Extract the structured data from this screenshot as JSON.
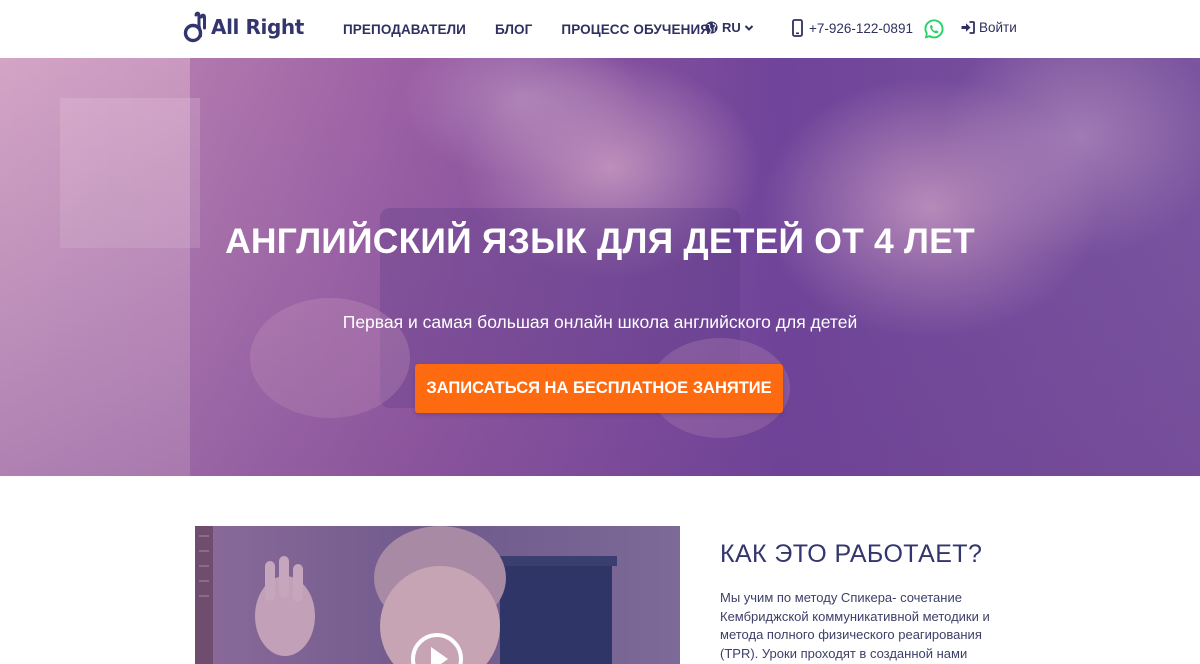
{
  "header": {
    "logo_text": "All Right",
    "nav": [
      {
        "label": "ПРЕПОДАВАТЕЛИ"
      },
      {
        "label": "БЛОГ"
      },
      {
        "label": "ПРОЦЕСС ОБУЧЕНИЯ"
      }
    ],
    "language": {
      "selected": "RU",
      "icon": "globe-icon"
    },
    "phone": {
      "number": "+7-926-122-0891",
      "icon": "mobile-phone-icon"
    },
    "whatsapp_icon": "whatsapp-icon",
    "login": {
      "label": "Войти",
      "icon": "sign-in-icon"
    }
  },
  "hero": {
    "title": "АНГЛИЙСКИЙ ЯЗЫК ДЛЯ ДЕТЕЙ ОТ 4 ЛЕТ",
    "subtitle": "Первая и самая большая онлайн школа английского для детей",
    "cta_label": "ЗАПИСАТЬСЯ НА БЕСПЛАТНОЕ ЗАНЯТИЕ"
  },
  "how_it_works": {
    "title": "КАК ЭТО РАБОТАЕТ?",
    "text": "Мы учим по методу Спикера- сочетание Кембриджской коммуникативной методики и метода полного физического реагирования (TPR). Уроки проходят в созданной нами"
  },
  "colors": {
    "brand": "#33356e",
    "cta": "#fe6a10",
    "hero_overlay": "#6b4a9c",
    "whatsapp": "#25d366"
  }
}
